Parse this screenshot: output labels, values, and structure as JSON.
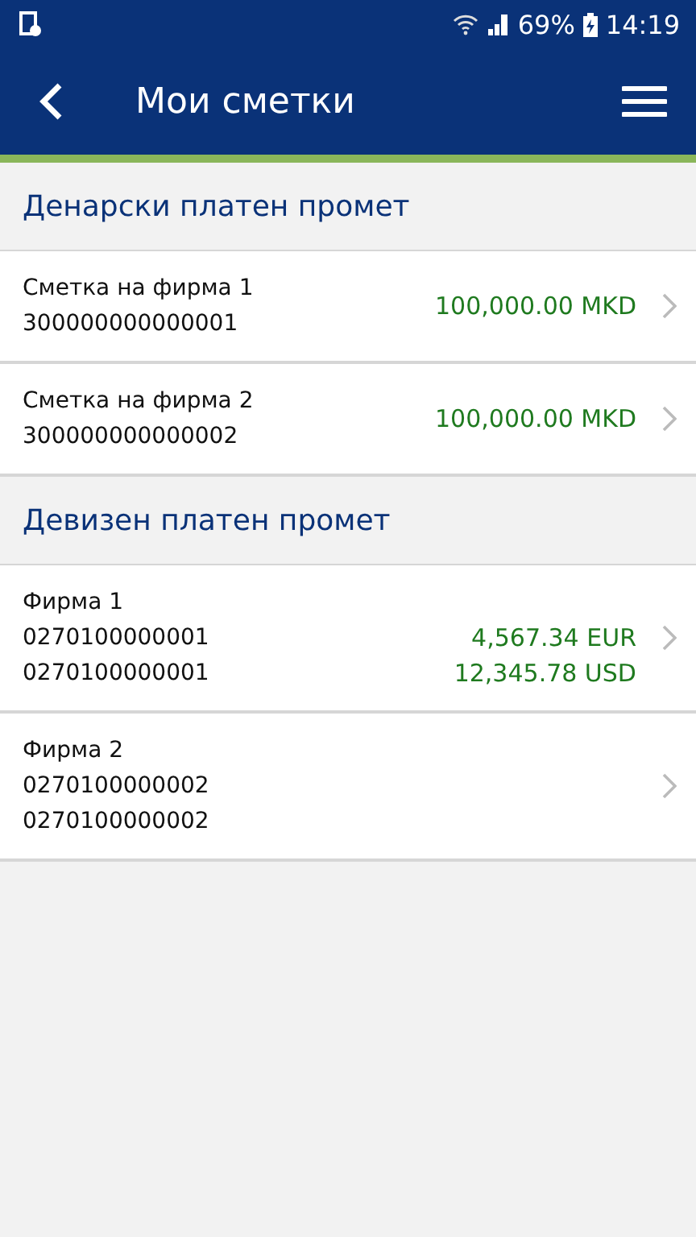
{
  "status_bar": {
    "time": "14:19",
    "battery": "69%"
  },
  "app_bar": {
    "title": "Мои сметки"
  },
  "sections": [
    {
      "title": "Денарски платен промет",
      "accounts": [
        {
          "name": "Сметка на фирма 1",
          "numbers": [
            "300000000000001"
          ],
          "amounts": [
            "100,000.00 MKD"
          ]
        },
        {
          "name": "Сметка на фирма 2",
          "numbers": [
            "300000000000002"
          ],
          "amounts": [
            "100,000.00 MKD"
          ]
        }
      ]
    },
    {
      "title": "Девизен платен промет",
      "accounts": [
        {
          "name": "Фирма 1",
          "numbers": [
            "0270100000001",
            "0270100000001"
          ],
          "amounts": [
            "4,567.34 EUR",
            "12,345.78 USD"
          ]
        },
        {
          "name": "Фирма 2",
          "numbers": [
            "0270100000002",
            "0270100000002"
          ]
        }
      ]
    }
  ]
}
